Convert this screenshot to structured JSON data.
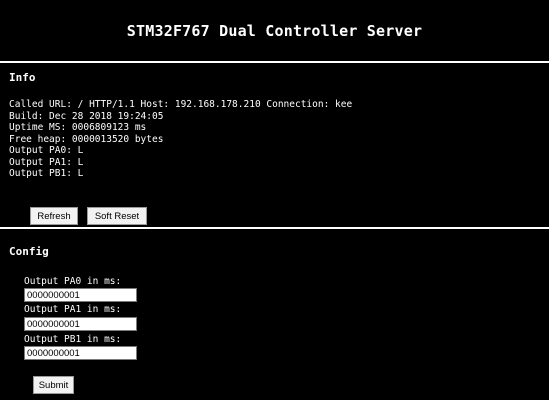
{
  "header": {
    "title": "STM32F767 Dual Controller Server"
  },
  "info": {
    "title": "Info",
    "lines": [
      "Called URL: / HTTP/1.1 Host: 192.168.178.210 Connection: kee",
      "Build: Dec 28 2018 19:24:05",
      "Uptime MS: 0006809123 ms",
      "Free heap: 0000013520 bytes",
      "Output PA0: L",
      "Output PA1: L",
      "Output PB1: L"
    ],
    "refresh_label": "Refresh",
    "soft_reset_label": "Soft Reset"
  },
  "config": {
    "title": "Config",
    "fields": [
      {
        "label": "Output PA0 in ms:",
        "value": "0000000001"
      },
      {
        "label": "Output PA1 in ms:",
        "value": "0000000001"
      },
      {
        "label": "Output PB1 in ms:",
        "value": "0000000001"
      }
    ],
    "submit_label": "Submit"
  }
}
